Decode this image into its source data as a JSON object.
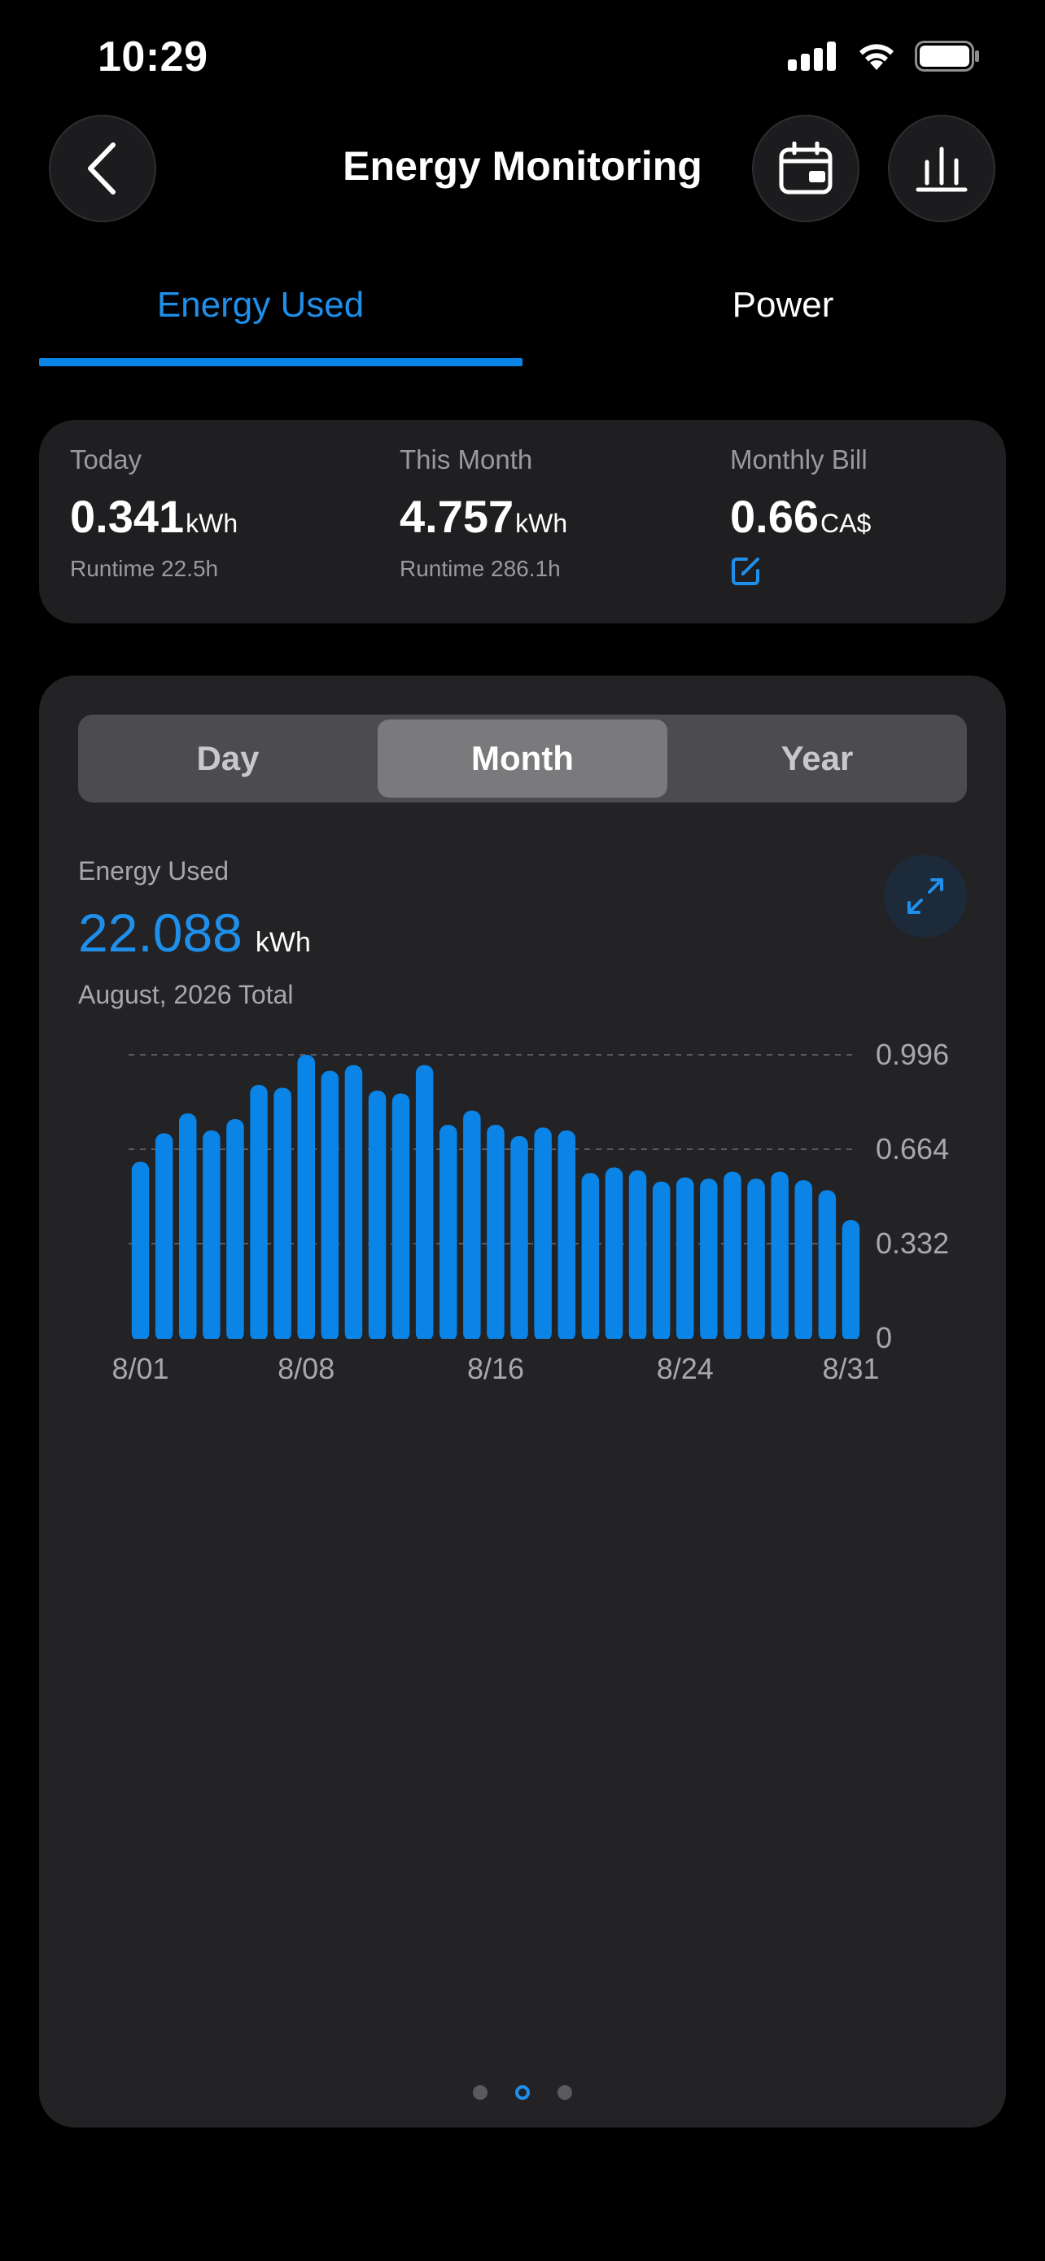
{
  "status_bar": {
    "time": "10:29"
  },
  "header": {
    "title": "Energy Monitoring"
  },
  "tabs": [
    {
      "label": "Energy Used",
      "active": true
    },
    {
      "label": "Power",
      "active": false
    }
  ],
  "summary": {
    "today": {
      "label": "Today",
      "value": "0.341",
      "unit": "kWh",
      "sub": "Runtime 22.5h"
    },
    "month": {
      "label": "This Month",
      "value": "4.757",
      "unit": "kWh",
      "sub": "Runtime 286.1h"
    },
    "bill": {
      "label": "Monthly Bill",
      "value": "0.66",
      "unit": "CA$"
    }
  },
  "segmented": {
    "options": [
      "Day",
      "Month",
      "Year"
    ],
    "selected": "Month"
  },
  "energy": {
    "label": "Energy Used",
    "total": "22.088",
    "unit": "kWh",
    "period": "August, 2026 Total"
  },
  "colors": {
    "accent": "#1e8fea",
    "background": "#000000",
    "card": "#232325"
  },
  "chart_data": {
    "type": "bar",
    "categories": [
      "8/01",
      "8/02",
      "8/03",
      "8/04",
      "8/05",
      "8/06",
      "8/07",
      "8/08",
      "8/09",
      "8/10",
      "8/11",
      "8/12",
      "8/13",
      "8/14",
      "8/15",
      "8/16",
      "8/17",
      "8/18",
      "8/19",
      "8/20",
      "8/21",
      "8/22",
      "8/23",
      "8/24",
      "8/25",
      "8/26",
      "8/27",
      "8/28",
      "8/29",
      "8/30",
      "8/31"
    ],
    "values": [
      0.62,
      0.72,
      0.79,
      0.73,
      0.77,
      0.89,
      0.88,
      0.996,
      0.94,
      0.96,
      0.87,
      0.86,
      0.96,
      0.75,
      0.8,
      0.75,
      0.71,
      0.74,
      0.73,
      0.58,
      0.6,
      0.59,
      0.55,
      0.565,
      0.56,
      0.585,
      0.56,
      0.585,
      0.555,
      0.52,
      0.415
    ],
    "x_tick_labels": [
      "8/01",
      "8/08",
      "8/16",
      "8/24",
      "8/31"
    ],
    "y_ticks": [
      0,
      0.332,
      0.664,
      0.996
    ],
    "ylim": [
      0,
      0.996
    ],
    "grid": true,
    "color": "#0a84e6"
  },
  "pagination": {
    "count": 3,
    "active": 1
  }
}
